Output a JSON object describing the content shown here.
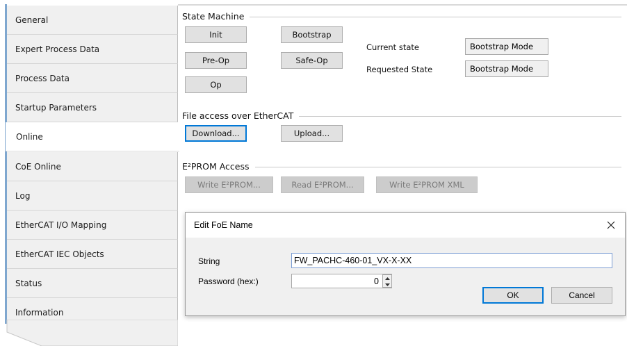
{
  "sidebar": {
    "items": [
      {
        "label": "General",
        "active": false
      },
      {
        "label": "Expert Process Data",
        "active": false
      },
      {
        "label": "Process Data",
        "active": false
      },
      {
        "label": "Startup Parameters",
        "active": false
      },
      {
        "label": "Online",
        "active": true
      },
      {
        "label": "CoE Online",
        "active": false
      },
      {
        "label": "Log",
        "active": false
      },
      {
        "label": "EtherCAT I/O Mapping",
        "active": false
      },
      {
        "label": "EtherCAT IEC Objects",
        "active": false
      },
      {
        "label": "Status",
        "active": false
      },
      {
        "label": "Information",
        "active": false
      }
    ]
  },
  "state_machine": {
    "title": "State Machine",
    "init_label": "Init",
    "bootstrap_label": "Bootstrap",
    "preop_label": "Pre-Op",
    "safeop_label": "Safe-Op",
    "op_label": "Op",
    "current_state_label": "Current state",
    "current_state_value": "Bootstrap Mode",
    "requested_state_label": "Requested State",
    "requested_state_value": "Bootstrap Mode"
  },
  "file_access": {
    "title": "File access over EtherCAT",
    "download_label": "Download...",
    "upload_label": "Upload..."
  },
  "eeprom": {
    "title": "E²PROM Access",
    "write_label": "Write E²PROM...",
    "read_label": "Read E²PROM...",
    "write_xml_label": "Write E²PROM XML"
  },
  "dialog": {
    "title": "Edit FoE Name",
    "string_label": "String",
    "string_value": "FW_PACHC-460-01_VX-X-XX",
    "password_label": "Password (hex:)",
    "password_value": "0",
    "ok_label": "OK",
    "cancel_label": "Cancel"
  },
  "colors": {
    "accent": "#0078d7",
    "sidebar_bg": "#f0f0f0",
    "sidebar_bar": "#7fa7cf"
  }
}
